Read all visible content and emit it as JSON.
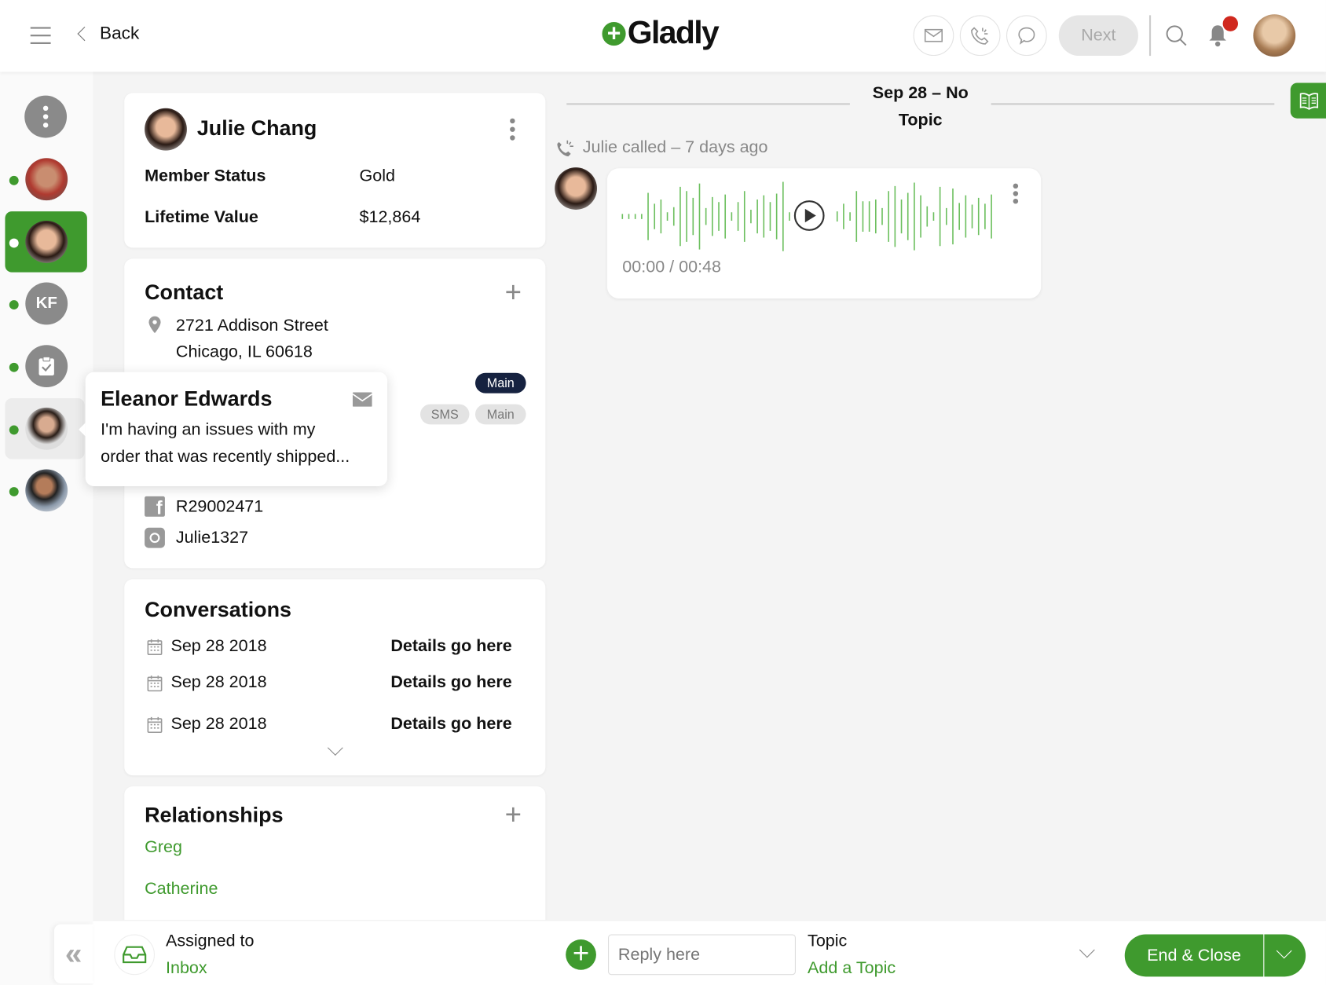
{
  "header": {
    "back_label": "Back",
    "logo": "Gladly",
    "next_label": "Next",
    "icons": [
      "menu-icon",
      "chevron-left-icon",
      "email-icon",
      "phone-icon",
      "chat-icon",
      "search-icon",
      "bell-icon"
    ],
    "brand_color": "#3f9a2e",
    "notification_color": "#d0281e"
  },
  "rail": {
    "items": [
      {
        "type": "menu"
      },
      {
        "type": "avatar",
        "online": true
      },
      {
        "type": "avatar",
        "online": true,
        "active": true
      },
      {
        "type": "initials",
        "label": "KF",
        "online": true
      },
      {
        "type": "task",
        "online": true
      },
      {
        "type": "avatar",
        "online": true,
        "hovered": true
      },
      {
        "type": "avatar",
        "online": true
      }
    ]
  },
  "profile": {
    "name": "Julie Chang",
    "fields": [
      {
        "label": "Member Status",
        "value": "Gold"
      },
      {
        "label": "Lifetime Value",
        "value": "$12,864"
      }
    ]
  },
  "contact": {
    "title": "Contact",
    "address_line1": "2721 Addison Street",
    "address_line2": "Chicago, IL 60618",
    "badge_primary": "Main",
    "badge_sms": "SMS",
    "badge_main": "Main",
    "facebook": "R29002471",
    "instagram": "Julie1327"
  },
  "popover": {
    "name": "Eleanor Edwards",
    "message_line1": "I'm having an issues with my",
    "message_line2": "order that was recently shipped..."
  },
  "conversations": {
    "title": "Conversations",
    "items": [
      {
        "date": "Sep 28 2018",
        "details": "Details go here"
      },
      {
        "date": "Sep 28 2018",
        "details": "Details go here"
      },
      {
        "date": "Sep 28 2018",
        "details": "Details go here"
      }
    ]
  },
  "relationships": {
    "title": "Relationships",
    "items": [
      "Greg",
      "Catherine"
    ]
  },
  "timeline": {
    "date_header_line1": "Sep 28 – No",
    "date_header_line2": "Topic",
    "call_text": "Julie called – 7 days ago",
    "audio_time": "00:00 / 00:48"
  },
  "bottom": {
    "assigned_label": "Assigned to",
    "assigned_value": "Inbox",
    "reply_placeholder": "Reply here",
    "topic_label": "Topic",
    "topic_value": "Add a Topic",
    "end_close_label": "End & Close"
  }
}
